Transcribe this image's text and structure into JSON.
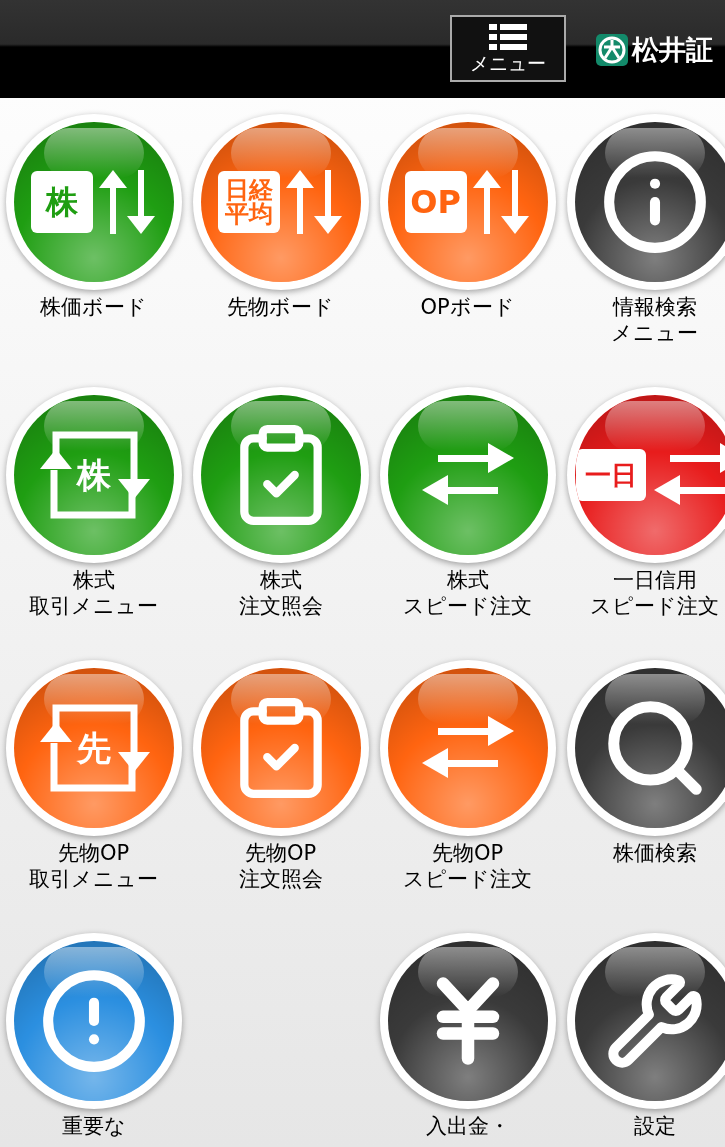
{
  "header": {
    "menu_button": "メニュー",
    "logo_text": "松井証"
  },
  "rows": [
    {
      "cells": [
        {
          "kind": "board",
          "color": "#1f9e12",
          "badge": "株",
          "label": [
            "株価ボード"
          ]
        },
        {
          "kind": "board",
          "color": "#ff6410",
          "badge": "日経平均",
          "label": [
            "先物ボード"
          ]
        },
        {
          "kind": "board",
          "color": "#ff6410",
          "badge": "OP",
          "label": [
            "OPボード"
          ]
        },
        {
          "kind": "info",
          "color": "#3a3a3a",
          "label": [
            "情報検索",
            "メニュー"
          ]
        }
      ]
    },
    {
      "cells": [
        {
          "kind": "trade",
          "color": "#1f9e12",
          "badge": "株",
          "label": [
            "株式",
            "取引メニュー"
          ]
        },
        {
          "kind": "order-list",
          "color": "#1f9e12",
          "label": [
            "株式",
            "注文照会"
          ]
        },
        {
          "kind": "speed",
          "color": "#1f9e12",
          "label": [
            "株式",
            "スピード注文"
          ]
        },
        {
          "kind": "speed-badge",
          "color": "#e81c1c",
          "badge": "一日",
          "label": [
            "一日信用",
            "スピード注文"
          ]
        }
      ]
    },
    {
      "cells": [
        {
          "kind": "trade",
          "color": "#ff6410",
          "badge": "先",
          "label": [
            "先物OP",
            "取引メニュー"
          ]
        },
        {
          "kind": "order-list",
          "color": "#ff6410",
          "label": [
            "先物OP",
            "注文照会"
          ]
        },
        {
          "kind": "speed",
          "color": "#ff6410",
          "label": [
            "先物OP",
            "スピード注文"
          ]
        },
        {
          "kind": "search",
          "color": "#3a3a3a",
          "label": [
            "株価検索"
          ]
        }
      ]
    },
    {
      "cells": [
        {
          "kind": "notice",
          "color": "#2b8fe0",
          "label": [
            "重要な"
          ]
        },
        {
          "kind": "blank"
        },
        {
          "kind": "yen",
          "color": "#3a3a3a",
          "label": [
            "入出金・"
          ]
        },
        {
          "kind": "settings",
          "color": "#3a3a3a",
          "label": [
            "設定"
          ]
        }
      ]
    }
  ]
}
